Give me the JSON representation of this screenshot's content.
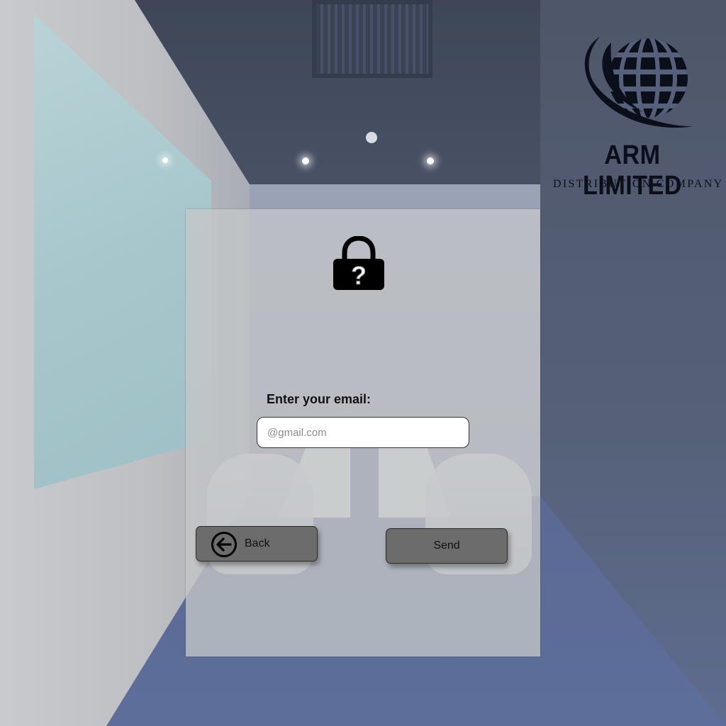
{
  "logo": {
    "title": "ARM LIMITED",
    "subtitle": "DISTRIBUTION COMPANY",
    "icon": "globe-swoosh-icon"
  },
  "form": {
    "icon": "lock-question-icon",
    "email_label": "Enter your email:",
    "email_placeholder": "@gmail.com",
    "email_value": ""
  },
  "buttons": {
    "back_label": "Back",
    "back_icon": "arrow-left-circle-icon",
    "send_label": "Send"
  },
  "colors": {
    "card_background": "#c4c6c8",
    "button_fill": "#6c6c6c",
    "logo_ink": "#0b0f1a"
  }
}
